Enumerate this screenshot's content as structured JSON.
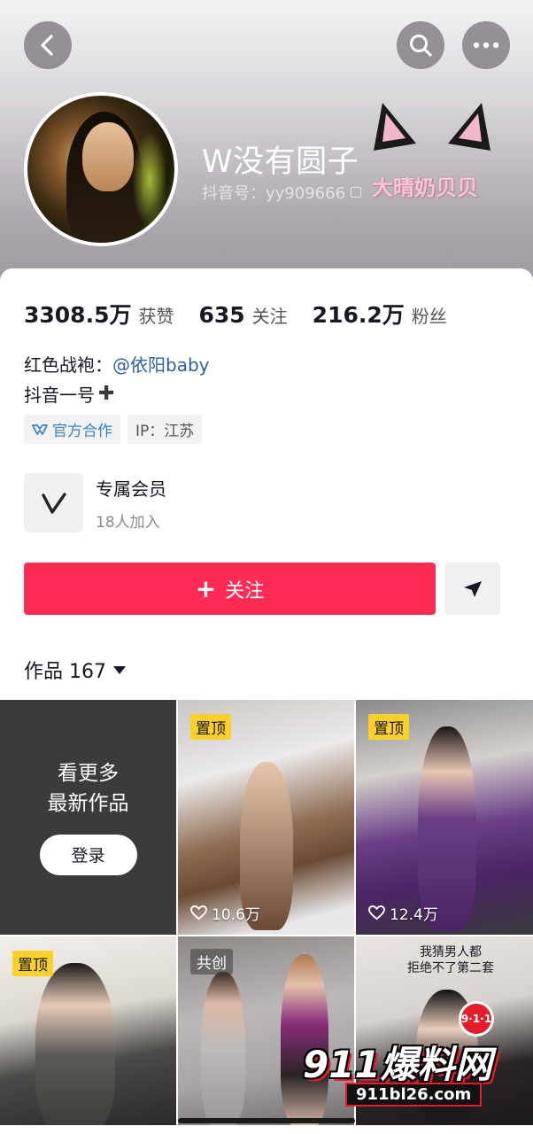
{
  "nav": {
    "back_icon": "chevron-left-icon",
    "search_icon": "search-icon",
    "more_icon": "more-horizontal-icon"
  },
  "profile": {
    "username": "W没有圆子",
    "douyin_id": "抖音号：yy909666",
    "overlay_watermark": "大晴奶贝贝"
  },
  "stats": [
    {
      "value": "3308.5万",
      "label": "获赞"
    },
    {
      "value": "635",
      "label": "关注"
    },
    {
      "value": "216.2万",
      "label": "粉丝"
    }
  ],
  "bio": {
    "line1_prefix": "红色战袍：",
    "line1_mention": "@依阳baby",
    "line2": "抖音一号",
    "line2_icon": "heavy-plus-icon"
  },
  "tags": {
    "official": "官方合作",
    "ip": "IP：江苏"
  },
  "membership": {
    "title": "专属会员",
    "subtitle": "18人加入"
  },
  "actions": {
    "follow_label": "关注",
    "send_icon": "paper-plane-icon"
  },
  "works": {
    "label": "作品 167"
  },
  "grid": {
    "promo_line1": "看更多",
    "promo_line2": "最新作品",
    "login_label": "登录",
    "items": [
      {
        "badge": "置顶",
        "likes": "10.6万"
      },
      {
        "badge": "置顶",
        "likes": "12.4万"
      },
      {
        "badge": "置顶"
      },
      {
        "badge": "共创"
      },
      {
        "caption_line1": "我猜男人都",
        "caption_line2": "拒绝不了第二套"
      }
    ]
  },
  "watermark_logo": {
    "main": "911爆料网",
    "url": "911bl26.com",
    "badge": "9·1·1"
  },
  "colors": {
    "accent": "#fe2c55",
    "mention": "#2f5f9e",
    "official_tag": "#3d84b8",
    "pin_badge": "#fbd02c"
  }
}
